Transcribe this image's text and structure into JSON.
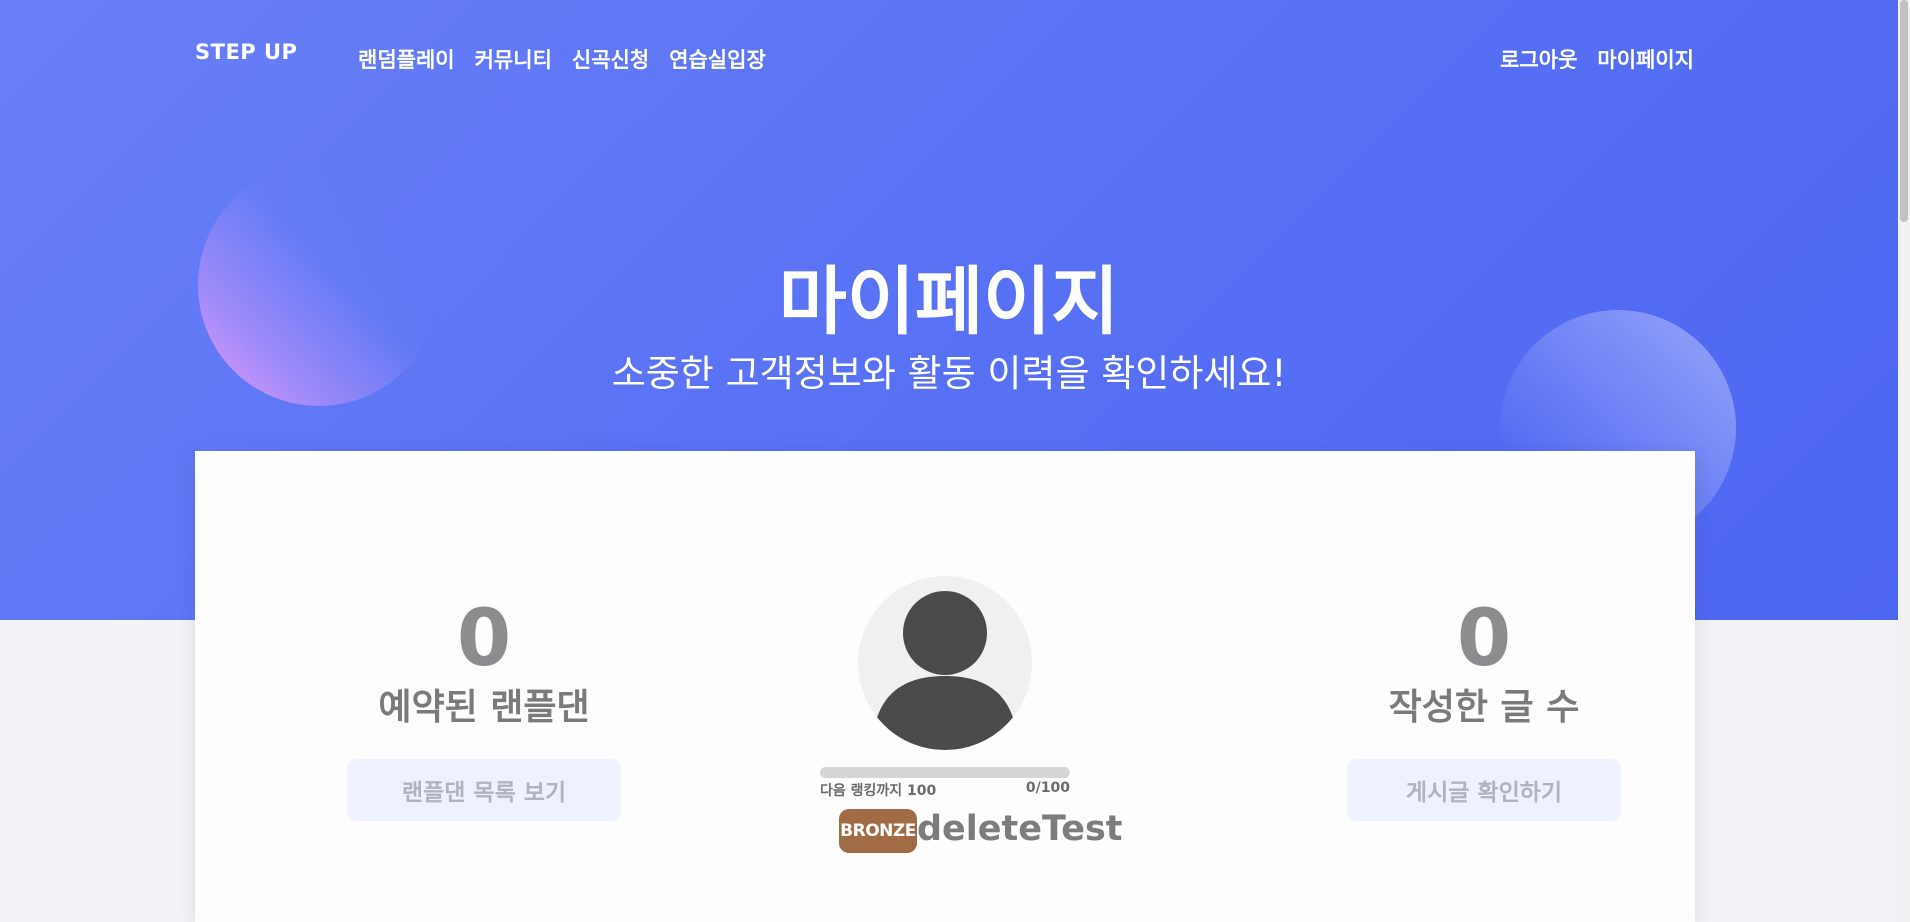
{
  "nav": {
    "brand": "STEP UP",
    "links": [
      "랜덤플레이",
      "커뮤니티",
      "신곡신청",
      "연습실입장"
    ],
    "right_links": [
      "로그아웃",
      "마이페이지"
    ]
  },
  "hero": {
    "title": "마이페이지",
    "subtitle": "소중한 고객정보와 활동 이력을 확인하세요!"
  },
  "stats": {
    "left": {
      "value": "0",
      "label": "예약된 랜플댄",
      "button": "랜플댄 목록 보기"
    },
    "right": {
      "value": "0",
      "label": "작성한 글 수",
      "button": "게시글 확인하기"
    }
  },
  "profile": {
    "progress_label": "다음 랭킹까지 100",
    "progress_value": "0/100",
    "progress_fraction": 0,
    "rank_badge": "BRONZE",
    "username": "deleteTest",
    "colors": {
      "badge": "#a06b45",
      "accent": "#5a72f4"
    }
  }
}
